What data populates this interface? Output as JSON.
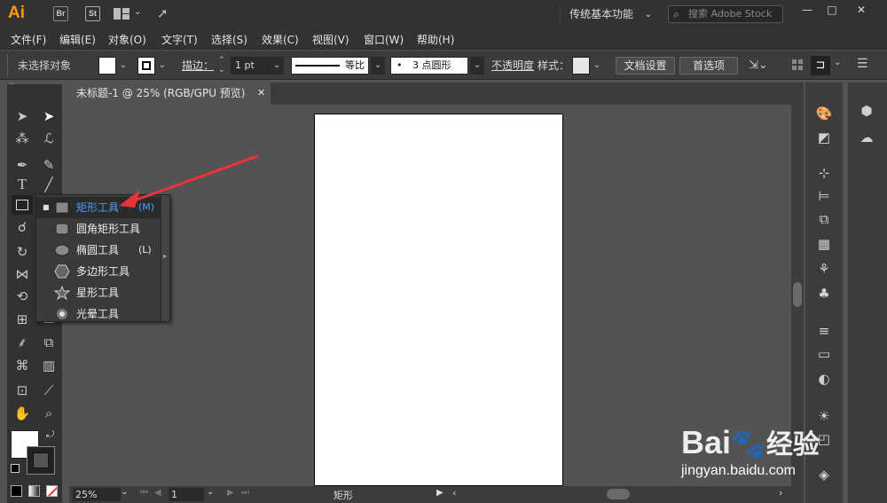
{
  "app": {
    "logo": "Ai",
    "bridge": "Br",
    "stock": "St"
  },
  "workspace": {
    "label": "传统基本功能"
  },
  "search": {
    "placeholder": "搜索 Adobe Stock"
  },
  "window_controls": {
    "minimize": "—",
    "restore": "□",
    "close": "✕"
  },
  "menubar": [
    "文件(F)",
    "编辑(E)",
    "对象(O)",
    "文字(T)",
    "选择(S)",
    "效果(C)",
    "视图(V)",
    "窗口(W)",
    "帮助(H)"
  ],
  "control_bar": {
    "selection": "未选择对象",
    "stroke_label": "描边：",
    "stroke_value": "1 pt",
    "profile_label": "等比",
    "brush_label": "3 点圆形",
    "opacity_label": "不透明度",
    "style_label": "样式：",
    "doc_setup": "文档设置",
    "preferences": "首选项"
  },
  "document_tab": {
    "title": "未标题-1 @ 25% (RGB/GPU 预览)",
    "close": "✕"
  },
  "flyout": {
    "items": [
      {
        "label": "矩形工具",
        "shortcut": "(M)",
        "icon": "rectangle-icon",
        "selected": true
      },
      {
        "label": "圆角矩形工具",
        "shortcut": "",
        "icon": "rounded-rectangle-icon",
        "selected": false
      },
      {
        "label": "椭圆工具",
        "shortcut": "(L)",
        "icon": "ellipse-icon",
        "selected": false
      },
      {
        "label": "多边形工具",
        "shortcut": "",
        "icon": "polygon-icon",
        "selected": false
      },
      {
        "label": "星形工具",
        "shortcut": "",
        "icon": "star-icon",
        "selected": false
      },
      {
        "label": "光晕工具",
        "shortcut": "",
        "icon": "flare-icon",
        "selected": false
      }
    ]
  },
  "status": {
    "zoom": "25%",
    "page": "1",
    "tool_name": "矩形"
  },
  "watermark": {
    "brand": "Bai",
    "brand2": "经验",
    "url": "jingyan.baidu.com"
  },
  "colors": {
    "accent": "#ff9a00",
    "arrow": "#e8343a",
    "selected_text": "#4a9df8",
    "artboard": "#ffffff"
  }
}
